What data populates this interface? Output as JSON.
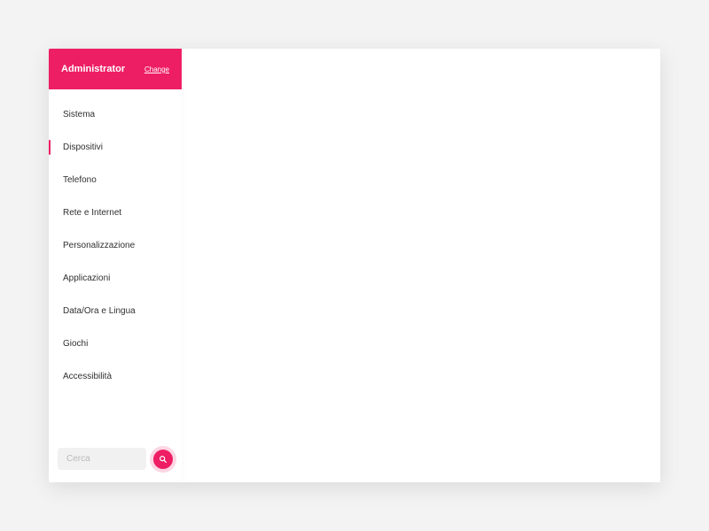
{
  "sidebar": {
    "title": "Administrator",
    "change_label": "Change",
    "items": [
      {
        "label": "Sistema",
        "active": false
      },
      {
        "label": "Dispositivi",
        "active": true
      },
      {
        "label": "Telefono",
        "active": false
      },
      {
        "label": "Rete e Internet",
        "active": false
      },
      {
        "label": "Personalizzazione",
        "active": false
      },
      {
        "label": "Applicazioni",
        "active": false
      },
      {
        "label": "Data/Ora e Lingua",
        "active": false
      },
      {
        "label": "Giochi",
        "active": false
      },
      {
        "label": "Accessibilità",
        "active": false
      }
    ]
  },
  "search": {
    "placeholder": "Cerca",
    "value": ""
  },
  "colors": {
    "accent": "#ee1e64"
  }
}
